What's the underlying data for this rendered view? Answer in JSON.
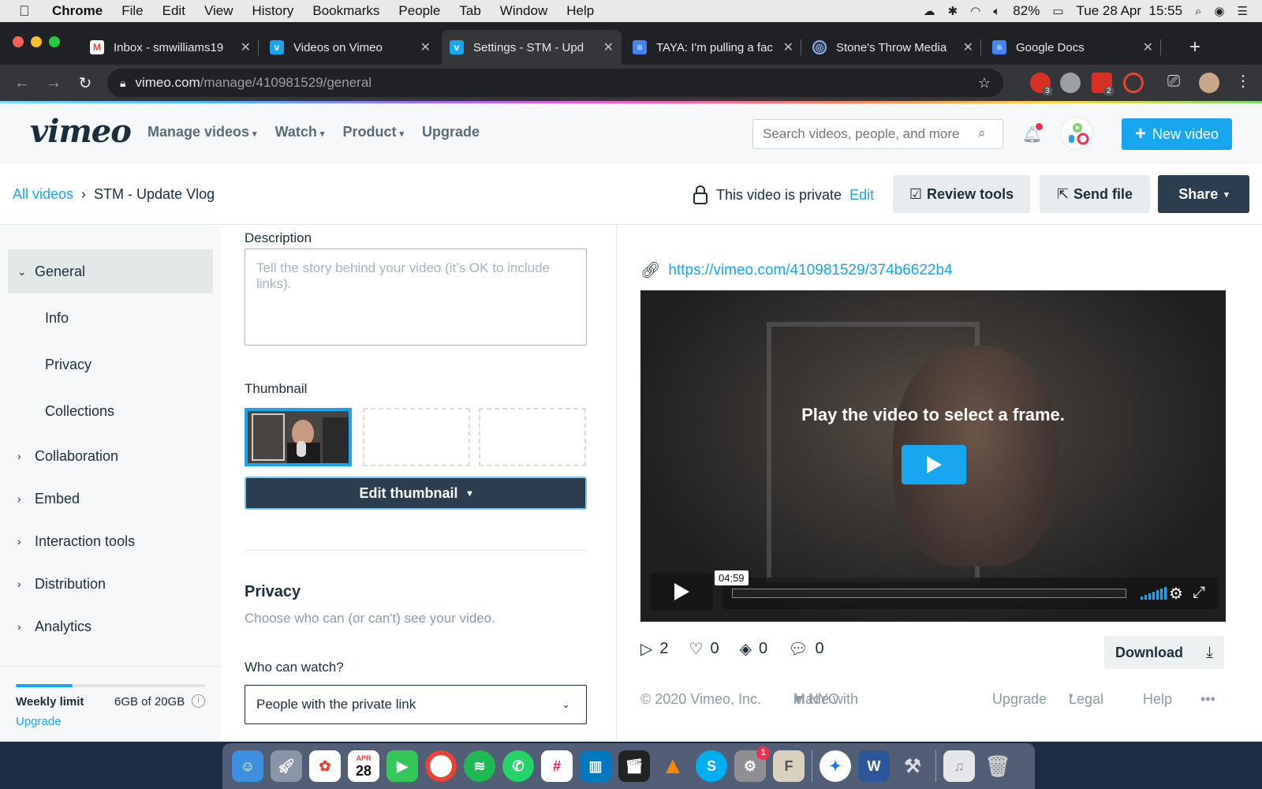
{
  "menubar": {
    "app": "Chrome",
    "items": [
      "File",
      "Edit",
      "View",
      "History",
      "Bookmarks",
      "People",
      "Tab",
      "Window",
      "Help"
    ],
    "battery": "82%",
    "datetime": "Tue 28 Apr  15:55"
  },
  "browser": {
    "tabs": [
      {
        "title": "Inbox - smwilliams19",
        "favicon": "gmail-icon",
        "color": "#ea4335"
      },
      {
        "title": "Videos on Vimeo",
        "favicon": "vimeo-icon",
        "color": "#17a6ef"
      },
      {
        "title": "Settings - STM - Upd",
        "favicon": "vimeo-icon",
        "color": "#17a6ef"
      },
      {
        "title": "TAYA: I'm pulling a fac",
        "favicon": "docs-icon",
        "color": "#4285f4"
      },
      {
        "title": "Stone's Throw Media",
        "favicon": "globe-icon",
        "color": "#8ab4f8"
      },
      {
        "title": "Google Docs",
        "favicon": "docs-icon",
        "color": "#4285f4"
      }
    ],
    "active_tab": 2,
    "url_host": "vimeo.com",
    "url_path": "/manage/410981529/general",
    "ext_badges": [
      "3",
      "2"
    ]
  },
  "vimeo": {
    "logo": "vimeo",
    "nav": [
      "Manage videos",
      "Watch",
      "Product",
      "Upgrade"
    ],
    "search_placeholder": "Search videos, people, and more",
    "new_video": "New video",
    "breadcrumb": {
      "root": "All videos",
      "current": "STM - Update Vlog"
    },
    "privacy_status": "This video is private",
    "privacy_edit": "Edit",
    "review_tools": "Review tools",
    "send_file": "Send file",
    "share": "Share",
    "sidebar": {
      "general": "General",
      "sub_items": [
        "Info",
        "Privacy",
        "Collections"
      ],
      "sections": [
        "Collaboration",
        "Embed",
        "Interaction tools",
        "Distribution",
        "Analytics"
      ],
      "weekly_limit_label": "Weekly limit",
      "weekly_limit_value": "6GB of 20GB",
      "weekly_limit_fraction": 0.3,
      "upgrade": "Upgrade"
    },
    "form": {
      "description_label": "Description",
      "description_placeholder": "Tell the story behind your video (it’s OK to include links).",
      "thumbnail_label": "Thumbnail",
      "edit_thumbnail": "Edit thumbnail",
      "privacy_heading": "Privacy",
      "privacy_sub": "Choose who can (or can't) see your video.",
      "who_can_watch": "Who can watch?",
      "who_value": "People with the private link"
    },
    "player": {
      "link": "https://vimeo.com/410981529/374b6622b4",
      "overlay": "Play the video to select a frame.",
      "duration": "04:59"
    },
    "stats": {
      "plays": "2",
      "likes": "0",
      "collections": "0",
      "comments": "0"
    },
    "download": "Download",
    "footer": {
      "copyright": "© 2020 Vimeo, Inc.",
      "made_with": "Made with",
      "in_nyc": "in NYC.",
      "upgrade": "Upgrade",
      "legal": "Legal",
      "help": "Help",
      "more": "•••"
    }
  },
  "dock": {
    "calendar_month": "APR",
    "calendar_day": "28",
    "prefs_badge": "1"
  },
  "colors": {
    "accent": "#17a6ef",
    "dark": "#2b3d4f"
  }
}
